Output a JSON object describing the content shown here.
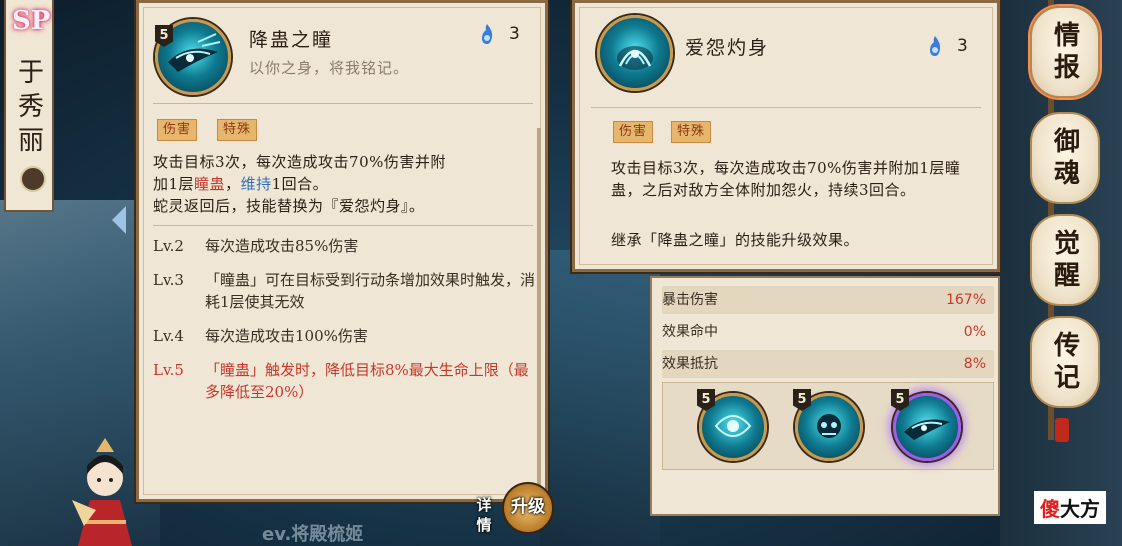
{
  "character": {
    "grade": "SP",
    "name": [
      "于",
      "秀",
      "丽"
    ]
  },
  "skill_left": {
    "level": "5",
    "title": "降蛊之瞳",
    "subtitle": "以你之身，将我铭记。",
    "cost": "3",
    "tags": [
      "伤害",
      "特殊"
    ],
    "desc_line1": "攻击目标3次，每次造成攻击70%伤害并附",
    "desc_line2_pre": "加1层",
    "desc_line2_red": "瞳蛊",
    "desc_line2_mid": "，",
    "desc_line2_blue": "维持",
    "desc_line2_post": "1回合。",
    "desc_line3": "蛇灵返回后，技能替换为『爱怨灼身』。",
    "levels": [
      {
        "lv": "Lv.2",
        "text": "每次造成攻击85%伤害"
      },
      {
        "lv": "Lv.3",
        "text": "「瞳蛊」可在目标受到行动条增加效果时触发，消耗1层使其无效"
      },
      {
        "lv": "Lv.4",
        "text": "每次造成攻击100%伤害"
      },
      {
        "lv": "Lv.5",
        "text": "「瞳蛊」触发时，降低目标8%最大生命上限（最多降低至20%）"
      }
    ]
  },
  "skill_right": {
    "title": "爱怨灼身",
    "cost": "3",
    "tags": [
      "伤害",
      "特殊"
    ],
    "desc": "攻击目标3次，每次造成攻击70%伤害并附加1层瞳蛊，之后对敌方全体附加怨火，持续3回合。",
    "inherit": "继承「降蛊之瞳」的技能升级效果。"
  },
  "stats": [
    {
      "label": "暴击伤害",
      "value": "167%"
    },
    {
      "label": "效果命中",
      "value": "0%"
    },
    {
      "label": "效果抵抗",
      "value": "8%"
    }
  ],
  "skill_tray": [
    {
      "level": "5",
      "selected": false
    },
    {
      "level": "5",
      "selected": false
    },
    {
      "level": "5",
      "selected": true
    }
  ],
  "menu": [
    {
      "label": "情报",
      "active": true
    },
    {
      "label": "御魂",
      "active": false
    },
    {
      "label": "觉醒",
      "active": false
    },
    {
      "label": "传记",
      "active": false
    }
  ],
  "buttons": {
    "detail": "详情",
    "upgrade": "升级"
  },
  "bottom_name": "ev.将殿梳姬",
  "watermark": {
    "red": "傻",
    "black": "大方"
  },
  "colors": {
    "accent_red": "#c7382a",
    "accent_blue": "#2f6fb3",
    "parchment": "#efe6d5",
    "frame": "#8a6a45"
  }
}
